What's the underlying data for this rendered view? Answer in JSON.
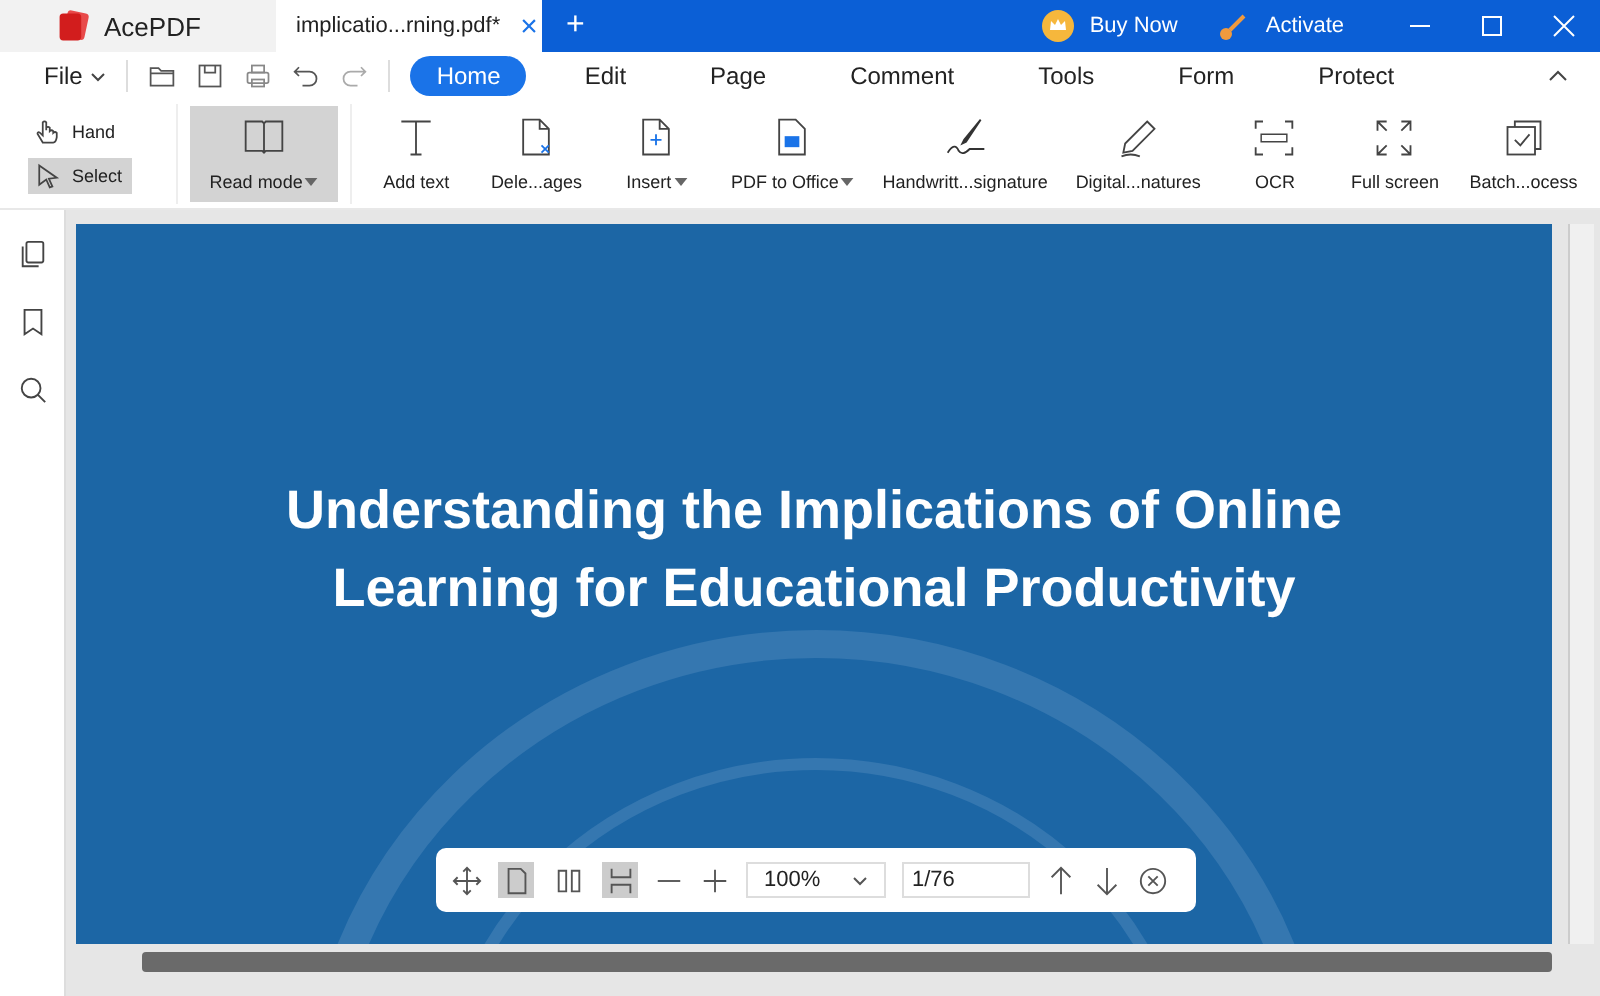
{
  "app": {
    "name": "AcePDF"
  },
  "document_tab": {
    "title": "implicatio...rning.pdf*",
    "close": "×"
  },
  "new_tab": "+",
  "title_actions": [
    {
      "label": "Buy Now"
    },
    {
      "label": "Activate"
    }
  ],
  "menu": {
    "file": "File",
    "tabs": [
      {
        "label": "Home",
        "selected": true
      },
      {
        "label": "Edit",
        "selected": false
      },
      {
        "label": "Page",
        "selected": false
      },
      {
        "label": "Comment",
        "selected": false
      },
      {
        "label": "Tools",
        "selected": false
      },
      {
        "label": "Form",
        "selected": false
      },
      {
        "label": "Protect",
        "selected": false
      }
    ]
  },
  "pointer_modes": [
    {
      "label": "Hand",
      "selected": false
    },
    {
      "label": "Select",
      "selected": true
    }
  ],
  "tools": [
    {
      "label": "Read mode",
      "dropdown": true,
      "selected": true
    },
    {
      "label": "Add text",
      "dropdown": false,
      "selected": false
    },
    {
      "label": "Dele...ages",
      "dropdown": false,
      "selected": false
    },
    {
      "label": "Insert",
      "dropdown": true,
      "selected": false
    },
    {
      "label": "PDF to Office",
      "dropdown": true,
      "selected": false
    },
    {
      "label": "Handwritt...signature",
      "dropdown": false,
      "selected": false
    },
    {
      "label": "Digital...natures",
      "dropdown": false,
      "selected": false
    },
    {
      "label": "OCR",
      "dropdown": false,
      "selected": false
    },
    {
      "label": "Full screen",
      "dropdown": false,
      "selected": false
    },
    {
      "label": "Batch...ocess",
      "dropdown": false,
      "selected": false
    }
  ],
  "page": {
    "title": "Understanding the Implications of Online Learning for Educational Productivity"
  },
  "page_bar": {
    "view_modes": [
      {
        "selected": true
      },
      {
        "selected": false
      },
      {
        "selected": true
      }
    ],
    "zoom": "100%",
    "page_number": "1/76"
  }
}
